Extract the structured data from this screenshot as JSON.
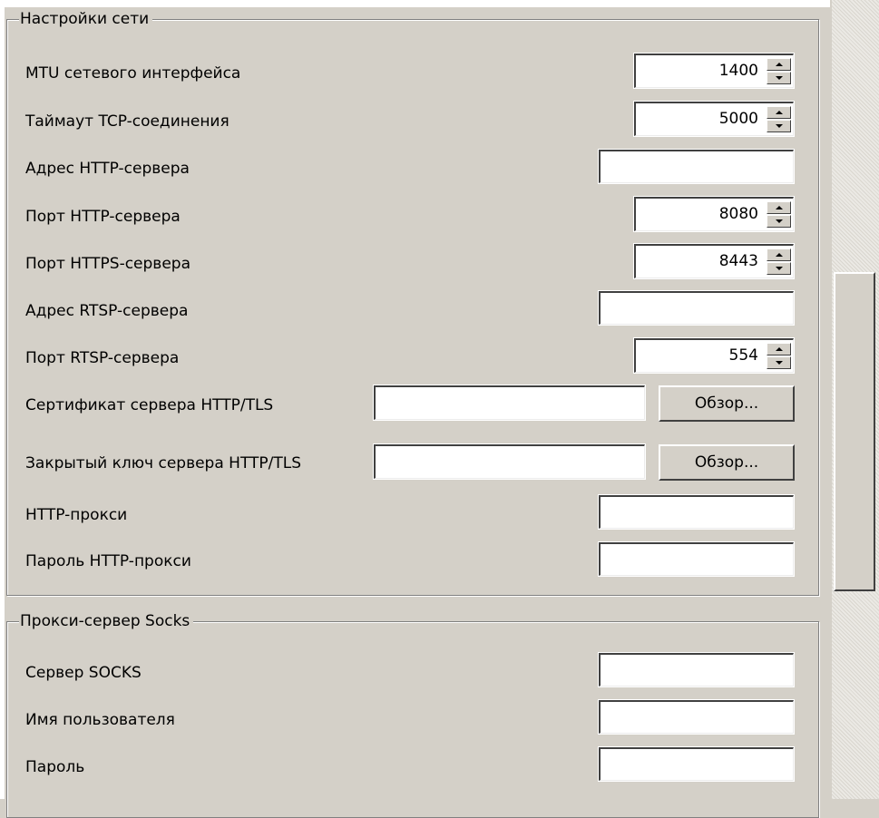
{
  "network_group": {
    "title": "Настройки сети",
    "mtu": {
      "label": "MTU сетевого интерфейса",
      "value": "1400"
    },
    "tcp_timeout": {
      "label": "Таймаут TCP-соединения",
      "value": "5000"
    },
    "http_address": {
      "label": "Адрес HTTP-сервера",
      "value": ""
    },
    "http_port": {
      "label": "Порт HTTP-сервера",
      "value": "8080"
    },
    "https_port": {
      "label": "Порт HTTPS-сервера",
      "value": "8443"
    },
    "rtsp_address": {
      "label": "Адрес RTSP-сервера",
      "value": ""
    },
    "rtsp_port": {
      "label": "Порт RTSP-сервера",
      "value": "554"
    },
    "tls_cert": {
      "label": "Сертификат сервера HTTP/TLS",
      "value": "",
      "browse_label": "Обзор..."
    },
    "tls_key": {
      "label": "Закрытый ключ сервера HTTP/TLS",
      "value": "",
      "browse_label": "Обзор..."
    },
    "http_proxy": {
      "label": "HTTP-прокси",
      "value": ""
    },
    "http_proxy_password": {
      "label": "Пароль HTTP-прокси",
      "value": ""
    }
  },
  "socks_group": {
    "title": "Прокси-сервер Socks",
    "server": {
      "label": "Сервер SOCKS",
      "value": ""
    },
    "username": {
      "label": "Имя пользователя",
      "value": ""
    },
    "password": {
      "label": "Пароль",
      "value": ""
    }
  },
  "icons": {
    "spin_up": "spin-up-arrow-icon",
    "spin_down": "spin-down-arrow-icon"
  },
  "colors": {
    "face": "#d4d0c8",
    "field": "#ffffff",
    "shadow": "#404040",
    "highlight": "#ffffff"
  }
}
